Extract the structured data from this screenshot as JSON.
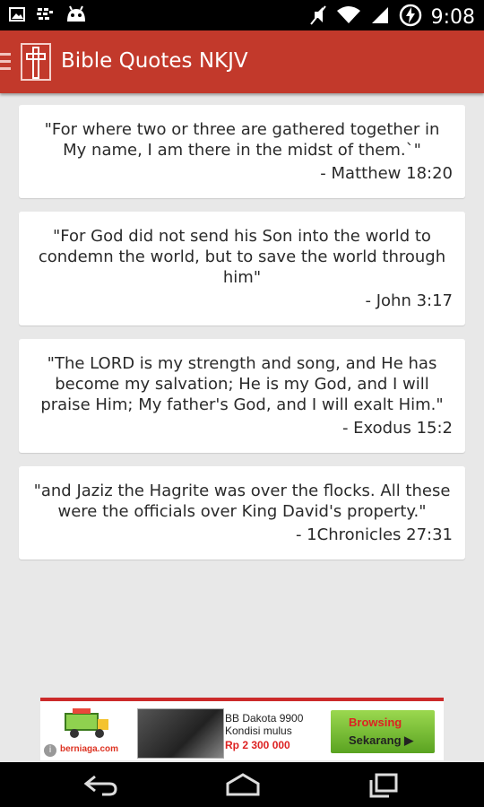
{
  "status_bar": {
    "time": "9:08"
  },
  "app": {
    "title": "Bible Quotes NKJV"
  },
  "quotes": [
    {
      "text": "\"For where two or three are gathered together in My name, I am there in the midst of them.`\"",
      "reference": "- Matthew 18:20"
    },
    {
      "text": "\"For God did not send his Son into the world to condemn the world, but to save the world through him\"",
      "reference": "- John 3:17"
    },
    {
      "text": "\"The LORD is my strength and song, and He has become my salvation; He is my God, and I will praise Him; My father's God, and I will exalt Him.\"",
      "reference": "- Exodus 15:2"
    },
    {
      "text": "\"and Jaziz the Hagrite was over the flocks. All these were the officials over King David's property.\"",
      "reference": "- 1Chronicles 27:31"
    }
  ],
  "ad": {
    "brand": "berniaga.com",
    "product_line1": "BB Dakota 9900",
    "product_line2": "Kondisi mulus",
    "price": "Rp 2 300 000",
    "cta_line1": "Browsing",
    "cta_line2": "Sekarang ▶"
  },
  "icons": [
    "image-icon",
    "bbm-icon",
    "android-icon",
    "mute-icon",
    "wifi-icon",
    "signal-icon",
    "battery-charging-icon",
    "drawer-menu-icon",
    "cross-logo-icon",
    "back-icon",
    "home-icon",
    "recents-icon"
  ]
}
